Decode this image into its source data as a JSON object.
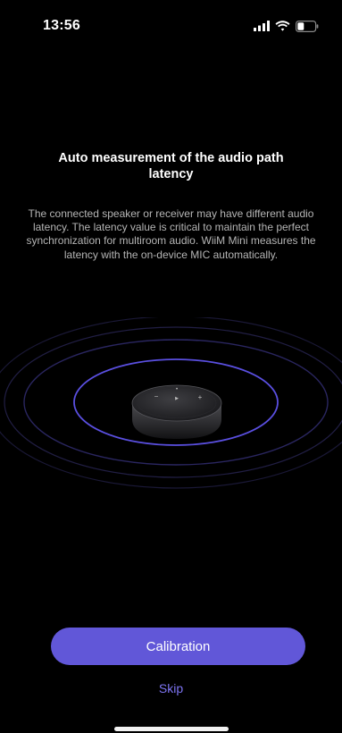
{
  "status_bar": {
    "time": "13:56",
    "icons": [
      "cellular-signal-icon",
      "wifi-icon",
      "battery-icon"
    ]
  },
  "content": {
    "title": "Auto measurement of the audio path latency",
    "description": "The connected speaker or receiver may have different audio latency. The latency value is critical to maintain the perfect synchronization for multiroom audio. WiiM Mini measures the latency with the on-device MIC automatically."
  },
  "device_controls": {
    "minus": "−",
    "plus": "+",
    "top_dot": "•",
    "play": "▶"
  },
  "actions": {
    "calibration_label": "Calibration",
    "skip_label": "Skip"
  },
  "colors": {
    "background": "#000000",
    "accent": "#6157d8",
    "link": "#7d74f2",
    "ring": "#5a4fe0"
  }
}
